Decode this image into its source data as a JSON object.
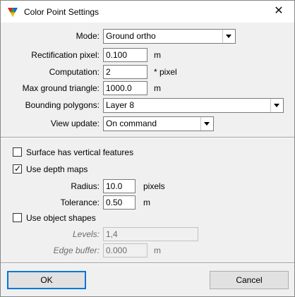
{
  "window": {
    "title": "Color Point Settings",
    "close": "✕"
  },
  "mode": {
    "label": "Mode:",
    "value": "Ground ortho"
  },
  "rect_pixel": {
    "label": "Rectification pixel:",
    "value": "0.100",
    "unit": "m"
  },
  "computation": {
    "label": "Computation:",
    "value": "2",
    "unit": "* pixel"
  },
  "max_tri": {
    "label": "Max ground triangle:",
    "value": "1000.0",
    "unit": "m"
  },
  "bounding": {
    "label": "Bounding polygons:",
    "value": "Layer 8"
  },
  "view_update": {
    "label": "View update:",
    "value": "On command"
  },
  "surface_vertical": {
    "label": "Surface has vertical features",
    "checked": false
  },
  "use_depth": {
    "label": "Use depth maps",
    "checked": true,
    "mark": "✓"
  },
  "radius": {
    "label": "Radius:",
    "value": "10.0",
    "unit": "pixels"
  },
  "tolerance": {
    "label": "Tolerance:",
    "value": "0.50",
    "unit": "m"
  },
  "use_object": {
    "label": "Use object shapes",
    "checked": false
  },
  "levels": {
    "label": "Levels:",
    "value": "1,4"
  },
  "edge_buffer": {
    "label": "Edge buffer:",
    "value": "0.000",
    "unit": "m"
  },
  "buttons": {
    "ok": "OK",
    "cancel": "Cancel"
  },
  "colors": {
    "accent": "#0078d7",
    "dialog_bg": "#f0f0f0"
  }
}
